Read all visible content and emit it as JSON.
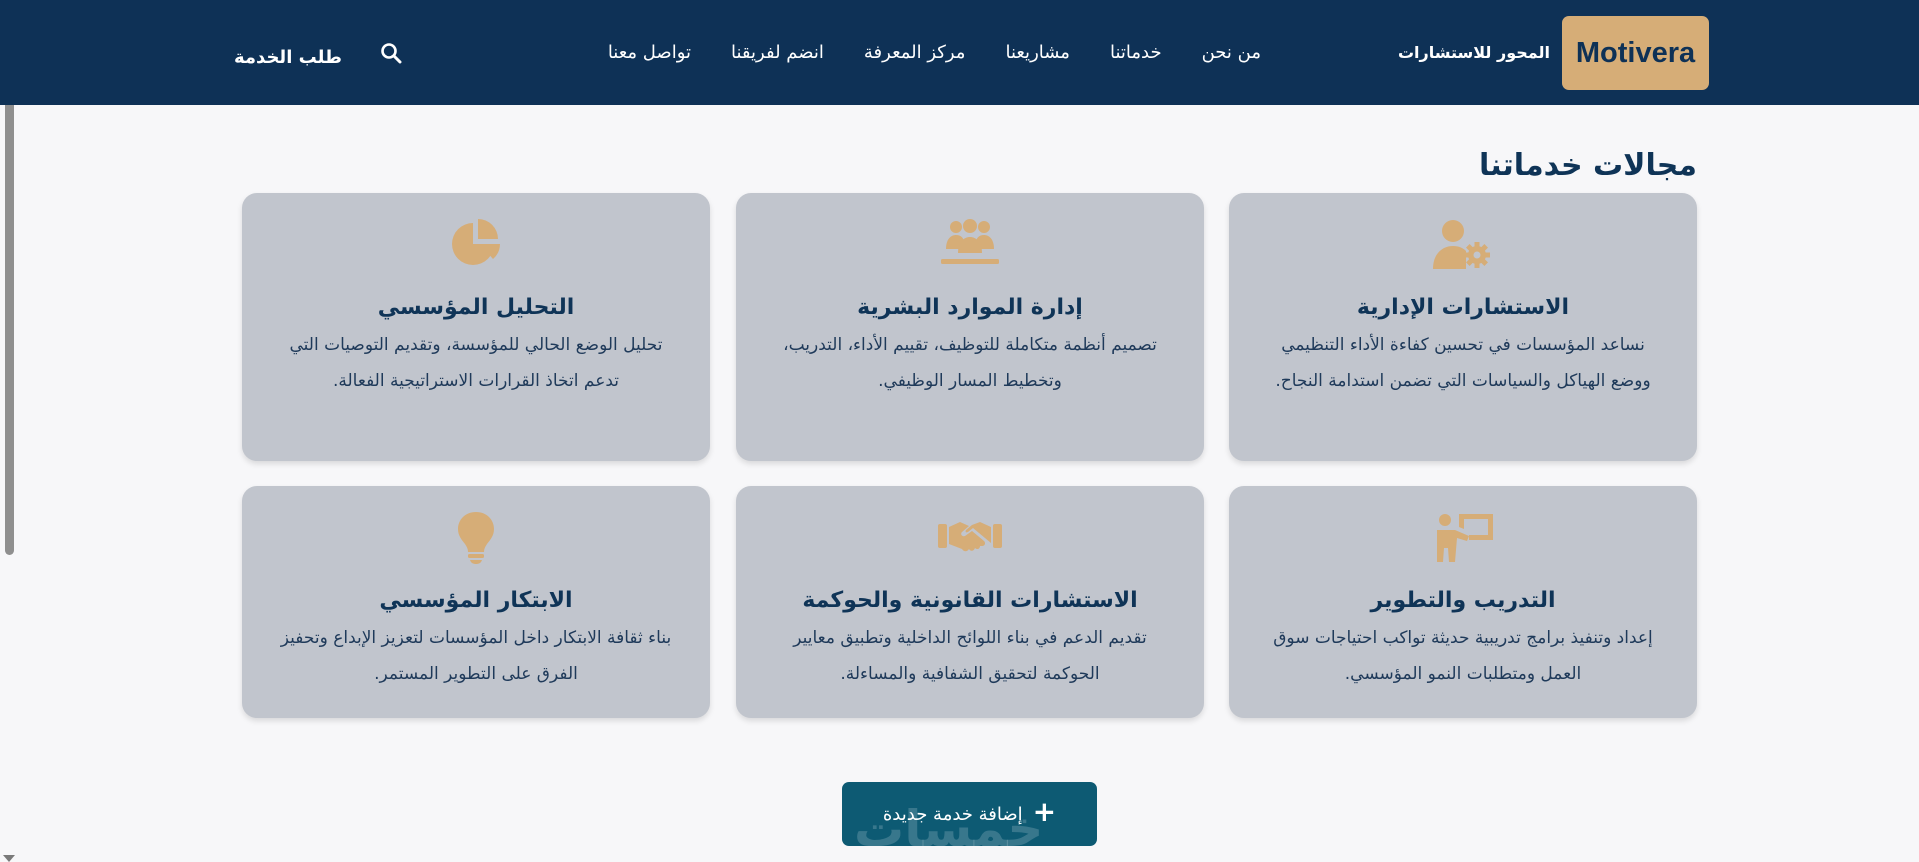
{
  "header": {
    "brand": "Motivera",
    "tagline": "المحور للاستشارات",
    "nav": [
      {
        "label": "من نحن"
      },
      {
        "label": "خدماتنا"
      },
      {
        "label": "مشاريعنا"
      },
      {
        "label": "مركز المعرفة"
      },
      {
        "label": "انضم لفريقنا"
      },
      {
        "label": "تواصل معنا"
      }
    ],
    "search_icon": "search-icon",
    "cta": "طلب الخدمة"
  },
  "section": {
    "title": "مجالات خدماتنا",
    "cards": [
      {
        "icon": "user-gear-icon",
        "title": "الاستشارات الإدارية",
        "description": "نساعد المؤسسات في تحسين كفاءة الأداء التنظيمي ووضع الهياكل والسياسات التي تضمن استدامة النجاح."
      },
      {
        "icon": "people-group-icon",
        "title": "إدارة الموارد البشرية",
        "description": "تصميم أنظمة متكاملة للتوظيف، تقييم الأداء، التدريب، وتخطيط المسار الوظيفي."
      },
      {
        "icon": "pie-chart-icon",
        "title": "التحليل المؤسسي",
        "description": "تحليل الوضع الحالي للمؤسسة، وتقديم التوصيات التي تدعم اتخاذ القرارات الاستراتيجية الفعالة."
      },
      {
        "icon": "presenter-board-icon",
        "title": "التدريب والتطوير",
        "description": "إعداد وتنفيذ برامج تدريبية حديثة تواكب احتياجات سوق العمل ومتطلبات النمو المؤسسي."
      },
      {
        "icon": "handshake-icon",
        "title": "الاستشارات القانونية والحوكمة",
        "description": "تقديم الدعم في بناء اللوائح الداخلية وتطبيق معايير الحوكمة لتحقيق الشفافية والمساءلة."
      },
      {
        "icon": "lightbulb-icon",
        "title": "الابتكار المؤسسي",
        "description": "بناء ثقافة الابتكار داخل المؤسسات لتعزيز الإبداع وتحفيز الفرق على التطوير المستمر."
      }
    ]
  },
  "add_button": {
    "label": "إضافة خدمة جديدة",
    "icon": "plus-icon"
  },
  "colors": {
    "navbar": "#0e3156",
    "brand_bg": "#d6ad77",
    "card_bg": "#c1c5cd",
    "icon_gold": "#d6ad77",
    "button_bg": "#0d5a73"
  }
}
